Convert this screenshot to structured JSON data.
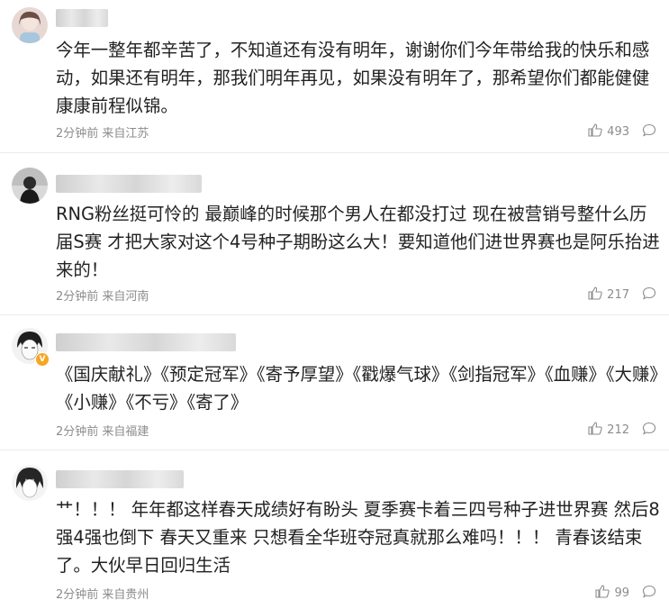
{
  "comments": [
    {
      "text": "今年一整年都辛苦了，不知道还有没有明年，谢谢你们今年带给我的快乐和感动，如果还有明年，那我们明年再见，如果没有明年了，那希望你们都能健健康康前程似锦。",
      "time": "2分钟前",
      "location": "来自江苏",
      "likes": "493"
    },
    {
      "text": "RNG粉丝挺可怜的 最巅峰的时候那个男人在都没打过 现在被营销号整什么历届S赛 才把大家对这个4号种子期盼这么大！要知道他们进世界赛也是阿乐抬进来的！",
      "time": "2分钟前",
      "location": "来自河南",
      "likes": "217"
    },
    {
      "text": "《国庆献礼》《预定冠军》《寄予厚望》《戳爆气球》《剑指冠军》《血赚》《大赚》《小赚》《不亏》《寄了》",
      "time": "2分钟前",
      "location": "来自福建",
      "likes": "212"
    },
    {
      "text": "艹！！！ 年年都这样春天成绩好有盼头 夏季赛卡着三四号种子进世界赛 然后8强4强也倒下 春天又重来 只想看全华班夺冠真就那么难吗！！！ 青春该结束了。大伙早日回归生活",
      "time": "2分钟前",
      "location": "来自贵州",
      "likes": "99"
    }
  ],
  "colors": {
    "meta": "#8c8c8c",
    "text": "#222222",
    "divider": "#ebebeb",
    "badge": "#f5a623"
  },
  "icons": {
    "like": "thumbs-up-icon",
    "reply": "comment-bubble-icon",
    "verified": "verified-badge-icon"
  }
}
